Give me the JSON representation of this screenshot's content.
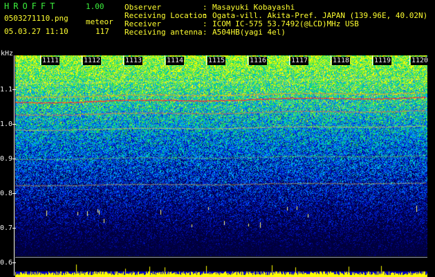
{
  "header": {
    "title": "HROFFT",
    "version": "1.00",
    "filename": "0503271110.png",
    "meteor_label": "meteor",
    "datetime": "05.03.27 11:10",
    "meteor_count": "117"
  },
  "info": [
    {
      "label": "Observer",
      "colon": ":",
      "value": "Masayuki Kobayashi"
    },
    {
      "label": "Receiving Location",
      "colon": ":",
      "value": "Ogata-vill. Akita-Pref. JAPAN (139.96E, 40.02N)"
    },
    {
      "label": "Receiver",
      "colon": ":",
      "value": "ICOM IC-575 53.7492(@LCD)MHz USB"
    },
    {
      "label": "Receiving antenna",
      "colon": ":",
      "value": "A504HB(yagi 4el)"
    }
  ],
  "axis": {
    "unit": "kHz",
    "ticks": [
      "1.1",
      "1.0",
      "0.9",
      "0.8",
      "0.7",
      "0.6"
    ]
  },
  "time_labels": [
    "1111",
    "1112",
    "1113",
    "1114",
    "1115",
    "1116",
    "1117",
    "1118",
    "1119",
    "1120"
  ],
  "colors": {
    "header_green": "#3cf03c",
    "header_yellow": "#ffff30",
    "echo_red": "#ff3030",
    "activity_yellow": "#ffff00"
  }
}
